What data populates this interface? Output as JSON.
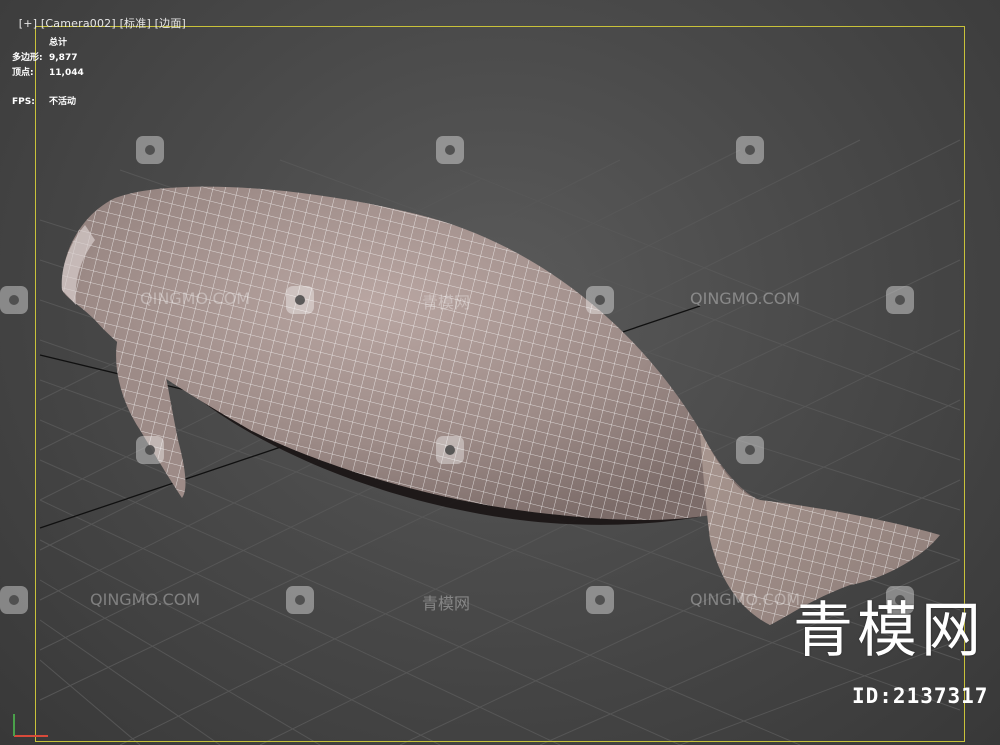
{
  "viewport": {
    "label_parts": [
      "[+]",
      "[Camera002]",
      "[标准]",
      "[边面]"
    ],
    "frame_color": "#c9c23a"
  },
  "stats": {
    "header": "总计",
    "polys_label": "多边形:",
    "polys_value": "9,877",
    "verts_label": "顶点:",
    "verts_value": "11,044",
    "fps_label": "FPS:",
    "fps_value": "不活动"
  },
  "watermark": {
    "text_en": "QINGMO.COM",
    "text_cn": "青模网",
    "icon": "qingmo-logo-icon"
  },
  "brand": {
    "logo_text": "青模网",
    "id_text": "ID:2137317"
  },
  "model": {
    "name": "manatee-mesh",
    "skin_color": "#a8938f",
    "wire_color": "#ffffff"
  }
}
